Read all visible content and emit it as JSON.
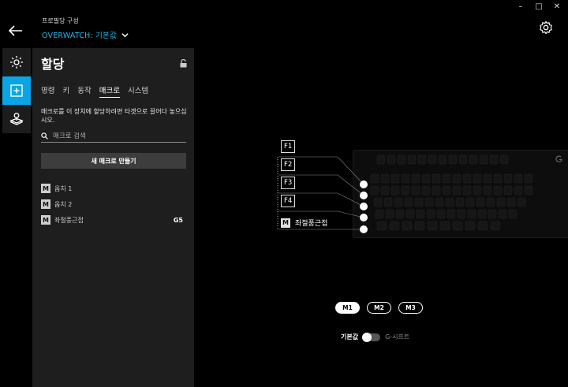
{
  "window": {
    "minimize": "–",
    "maximize": "□",
    "close": "✕"
  },
  "header": {
    "profile_label": "프로필당 구성",
    "profile_name": "OVERWATCH: 기본값"
  },
  "rail": {
    "items": [
      "lighting-icon",
      "assignment-icon",
      "game-mode-icon"
    ]
  },
  "panel": {
    "title": "할당",
    "tabs": [
      "명령",
      "키",
      "동작",
      "매크로",
      "시스템"
    ],
    "active_tab": "매크로",
    "hint": "매크로를 이 장치에 할당하려면 타겟으로 끌어다 놓으십시오.",
    "search_placeholder": "매크로 검색",
    "new_macro_label": "새 매크로 만들기",
    "macros": [
      {
        "badge": "M",
        "name": "옵치 1",
        "key": ""
      },
      {
        "badge": "M",
        "name": "옵치 2",
        "key": ""
      },
      {
        "badge": "M",
        "name": "좌절풍근접",
        "key": "G5"
      }
    ]
  },
  "device": {
    "fkeys": [
      "F1",
      "F2",
      "F3",
      "F4"
    ],
    "assigned": {
      "badge": "M",
      "name": "좌절풍근접"
    }
  },
  "modes": {
    "buttons": [
      "M1",
      "M2",
      "M3"
    ],
    "active": "M1"
  },
  "shift_toggle": {
    "left_label": "기본값",
    "right_label": "G-시프트",
    "state": "off"
  },
  "colors": {
    "accent": "#21b8f0",
    "active_rail": "#0aa5e6",
    "panel": "#1e1e1e"
  }
}
